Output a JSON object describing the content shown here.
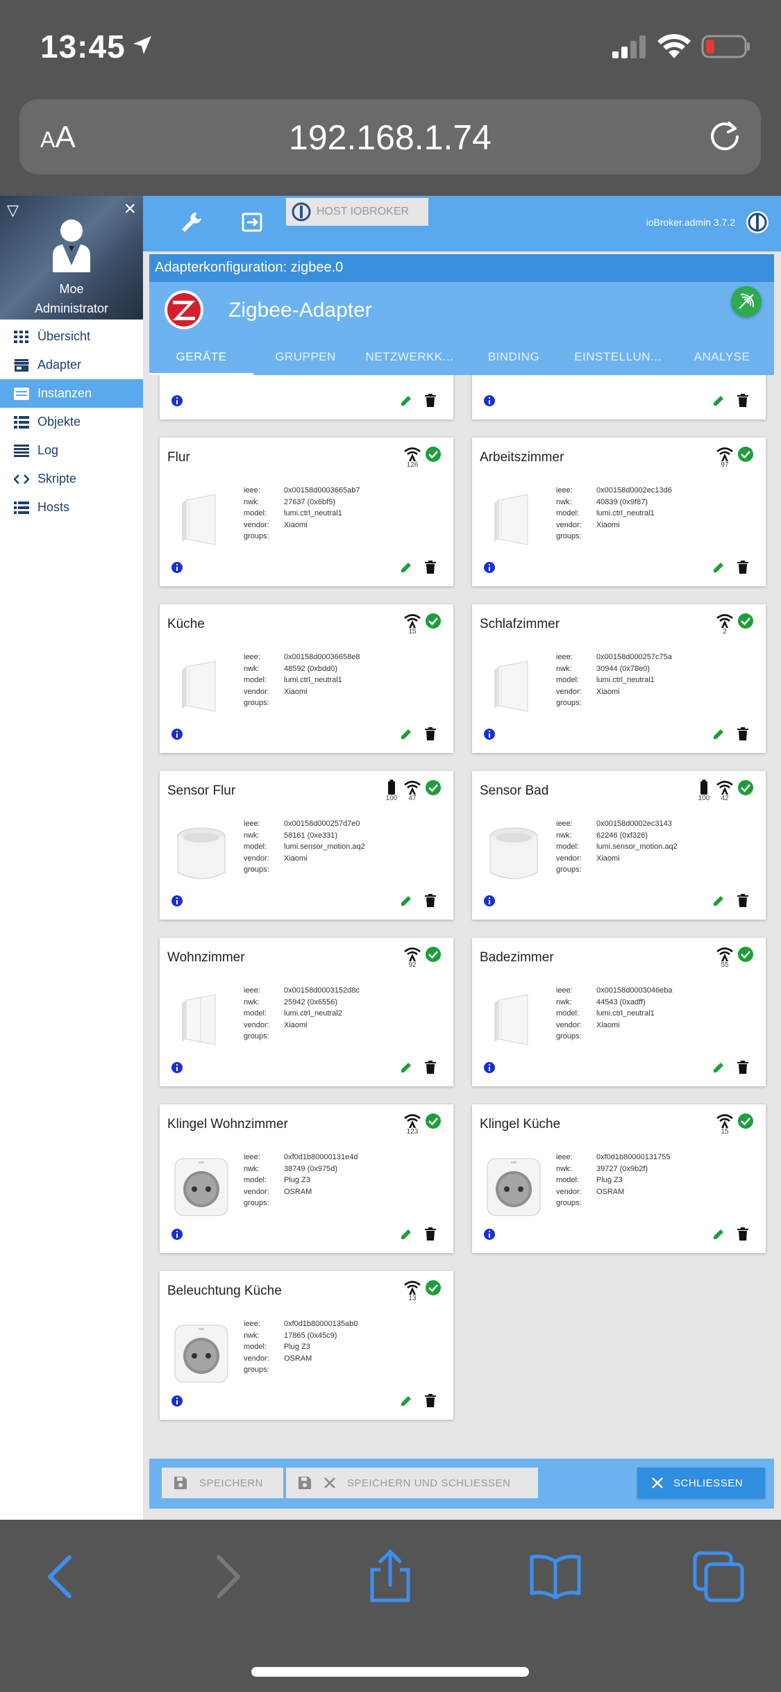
{
  "status_bar": {
    "time": "13:45"
  },
  "browser": {
    "text_size_label_small": "A",
    "text_size_label_big": "A",
    "url": "192.168.1.74"
  },
  "sidebar": {
    "user_name": "Moe",
    "user_role": "Administrator",
    "items": [
      {
        "label": "Übersicht",
        "icon": "grid-icon"
      },
      {
        "label": "Adapter",
        "icon": "store-icon"
      },
      {
        "label": "Instanzen",
        "icon": "instances-icon"
      },
      {
        "label": "Objekte",
        "icon": "list-icon"
      },
      {
        "label": "Log",
        "icon": "log-icon"
      },
      {
        "label": "Skripte",
        "icon": "code-icon"
      },
      {
        "label": "Hosts",
        "icon": "hosts-icon"
      }
    ],
    "active_index": 2
  },
  "topbar": {
    "host_label": "HOST IOBROKER",
    "admin_version": "ioBroker.admin 3.7.2"
  },
  "dialog": {
    "title": "Adapterkonfiguration: zigbee.0",
    "adapter_name": "Zigbee-Adapter",
    "tabs": [
      "GERÄTE",
      "GRUPPEN",
      "NETZWERKK...",
      "BINDING",
      "EINSTELLUN...",
      "ANALYSE"
    ],
    "active_tab": 0
  },
  "labels": {
    "ieee": "ieee:",
    "nwk": "nwk:",
    "model": "model:",
    "vendor": "vendor:",
    "groups": "groups:"
  },
  "devices": [
    {
      "name": "Flur",
      "ieee": "0x00158d0003665ab7",
      "nwk": "27637 (0x6bf5)",
      "model": "lumi.ctrl_neutral1",
      "vendor": "Xiaomi",
      "groups": "",
      "link": "126",
      "battery": "",
      "kind": "switch",
      "status_color": "#1e9e3a"
    },
    {
      "name": "Arbeitszimmer",
      "ieee": "0x00158d0002ec13d6",
      "nwk": "40839 (0x9f87)",
      "model": "lumi.ctrl_neutral1",
      "vendor": "Xiaomi",
      "groups": "",
      "link": "97",
      "battery": "",
      "kind": "switch",
      "status_color": "#1e9e3a"
    },
    {
      "name": "Küche",
      "ieee": "0x00158d00036658e8",
      "nwk": "48592 (0xbdd0)",
      "model": "lumi.ctrl_neutral1",
      "vendor": "Xiaomi",
      "groups": "",
      "link": "15",
      "battery": "",
      "kind": "switch",
      "status_color": "#1e9e3a"
    },
    {
      "name": "Schlafzimmer",
      "ieee": "0x00158d000257c75a",
      "nwk": "30944 (0x78e0)",
      "model": "lumi.ctrl_neutral1",
      "vendor": "Xiaomi",
      "groups": "",
      "link": "2",
      "battery": "",
      "kind": "switch",
      "status_color": "#1e9e3a"
    },
    {
      "name": "Sensor Flur",
      "ieee": "0x00158d000257d7e0",
      "nwk": "58161 (0xe331)",
      "model": "lumi.sensor_motion.aq2",
      "vendor": "Xiaomi",
      "groups": "",
      "link": "47",
      "battery": "100",
      "kind": "sensor",
      "status_color": "#1e9e3a"
    },
    {
      "name": "Sensor Bad",
      "ieee": "0x00158d0002ec3143",
      "nwk": "62246 (0xf326)",
      "model": "lumi.sensor_motion.aq2",
      "vendor": "Xiaomi",
      "groups": "",
      "link": "42",
      "battery": "100",
      "kind": "sensor",
      "status_color": "#1e9e3a"
    },
    {
      "name": "Wohnzimmer",
      "ieee": "0x00158d0003152d8c",
      "nwk": "25942 (0x6556)",
      "model": "lumi.ctrl_neutral2",
      "vendor": "Xiaomi",
      "groups": "",
      "link": "92",
      "battery": "",
      "kind": "switch2",
      "status_color": "#1e9e3a"
    },
    {
      "name": "Badezimmer",
      "ieee": "0x00158d0003046eba",
      "nwk": "44543 (0xadff)",
      "model": "lumi.ctrl_neutral1",
      "vendor": "Xiaomi",
      "groups": "",
      "link": "55",
      "battery": "",
      "kind": "switch",
      "status_color": "#1e9e3a"
    },
    {
      "name": "Klingel Wohnzimmer",
      "ieee": "0xf0d1b80000131e4d",
      "nwk": "38749 (0x975d)",
      "model": "Plug Z3",
      "vendor": "OSRAM",
      "groups": "",
      "link": "123",
      "battery": "",
      "kind": "plug",
      "status_color": "#1e9e3a"
    },
    {
      "name": "Klingel Küche",
      "ieee": "0xf0d1b80000131755",
      "nwk": "39727 (0x9b2f)",
      "model": "Plug Z3",
      "vendor": "OSRAM",
      "groups": "",
      "link": "15",
      "battery": "",
      "kind": "plug",
      "status_color": "#1e9e3a"
    },
    {
      "name": "Beleuchtung Küche",
      "ieee": "0xf0d1b80000135ab0",
      "nwk": "17865 (0x45c9)",
      "model": "Plug Z3",
      "vendor": "OSRAM",
      "groups": "",
      "link": "13",
      "battery": "",
      "kind": "plug",
      "status_color": "#1e9e3a"
    }
  ],
  "footer": {
    "save_label": "SPEICHERN",
    "save_close_label": "SPEICHERN UND SCHLIESSEN",
    "close_label": "SCHLIESSEN"
  },
  "colors": {
    "accent": "#5aa8ee",
    "header": "#6db3f0",
    "title": "#3a8fdd",
    "ok": "#1e9e3a",
    "edit": "#1e9e3a",
    "info": "#1a2fd6"
  }
}
